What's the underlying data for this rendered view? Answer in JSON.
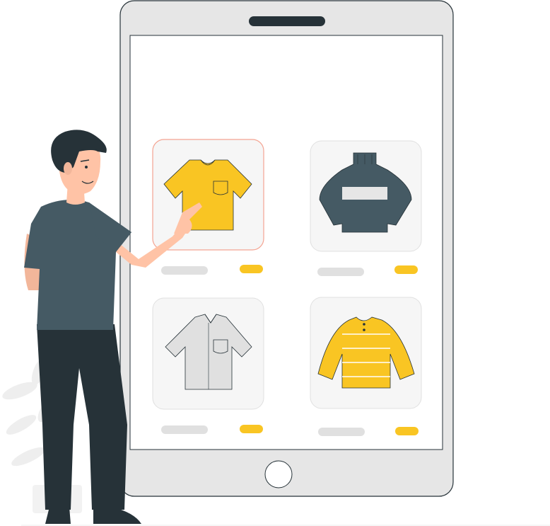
{
  "colors": {
    "accent": "#f9c523",
    "dark_slate": "#455a64",
    "dark": "#263238",
    "tablet_frame": "#e6e6e6",
    "card_bg": "#f6f6f6",
    "placeholder_grey": "#e0e0e0",
    "skin": "#ffc3a6"
  },
  "products": [
    {
      "name": "yellow-tshirt",
      "selected": true
    },
    {
      "name": "dark-sweater",
      "selected": false
    },
    {
      "name": "grey-shirt",
      "selected": false
    },
    {
      "name": "yellow-striped-sweater",
      "selected": false
    }
  ],
  "icons": [
    "home-button-icon",
    "tshirt-icon",
    "sweater-icon",
    "shirt-icon",
    "striped-sweater-icon"
  ]
}
